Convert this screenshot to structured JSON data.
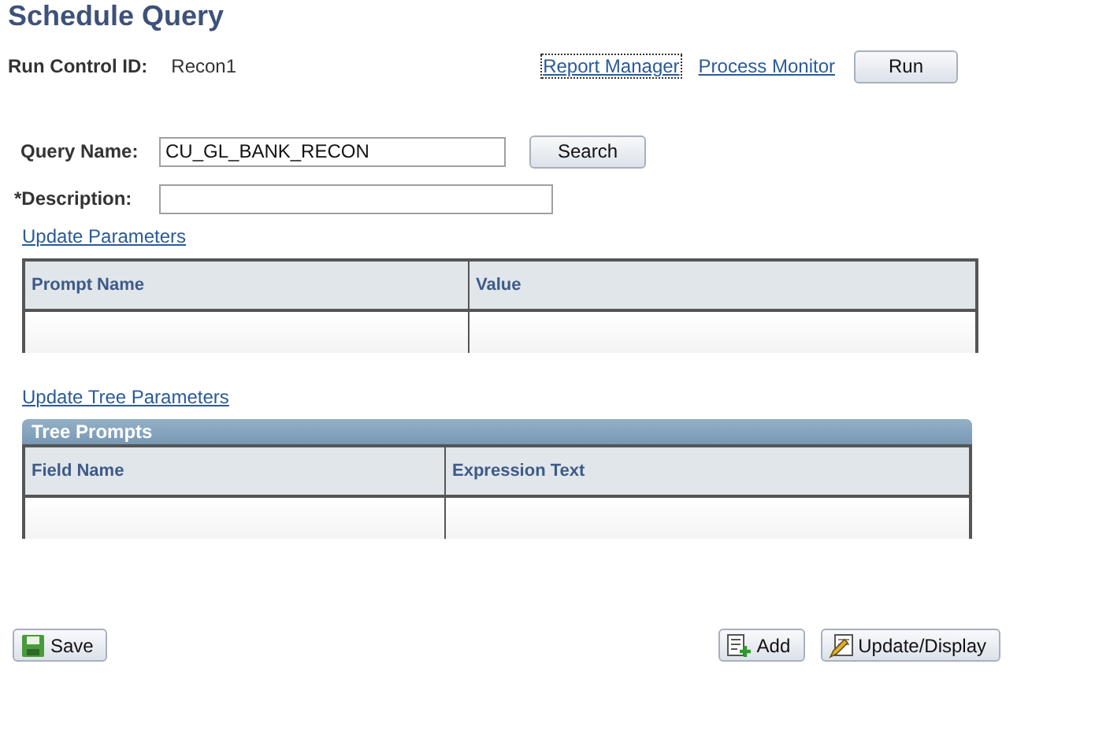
{
  "page_title": "Schedule Query",
  "run_control": {
    "label": "Run Control ID:",
    "value": "Recon1"
  },
  "header_links": [
    {
      "label": "Report Manager",
      "focused": true
    },
    {
      "label": "Process Monitor",
      "focused": false
    }
  ],
  "run_button": "Run",
  "query_name": {
    "label": "Query Name:",
    "value": "CU_GL_BANK_RECON"
  },
  "search_button": "Search",
  "description": {
    "label": "*Description:"
  },
  "update_parameters_link": "Update Parameters",
  "parameters_grid": {
    "columns": [
      "Prompt Name",
      "Value"
    ]
  },
  "update_tree_parameters_link": "Update Tree Parameters",
  "tree_prompts": {
    "title": "Tree Prompts",
    "columns": [
      "Field Name",
      "Expression Text"
    ]
  },
  "footer_buttons": [
    {
      "kind": "save",
      "label": "Save"
    },
    {
      "kind": "add",
      "label": "Add"
    },
    {
      "kind": "update",
      "label": "Update/Display"
    }
  ]
}
